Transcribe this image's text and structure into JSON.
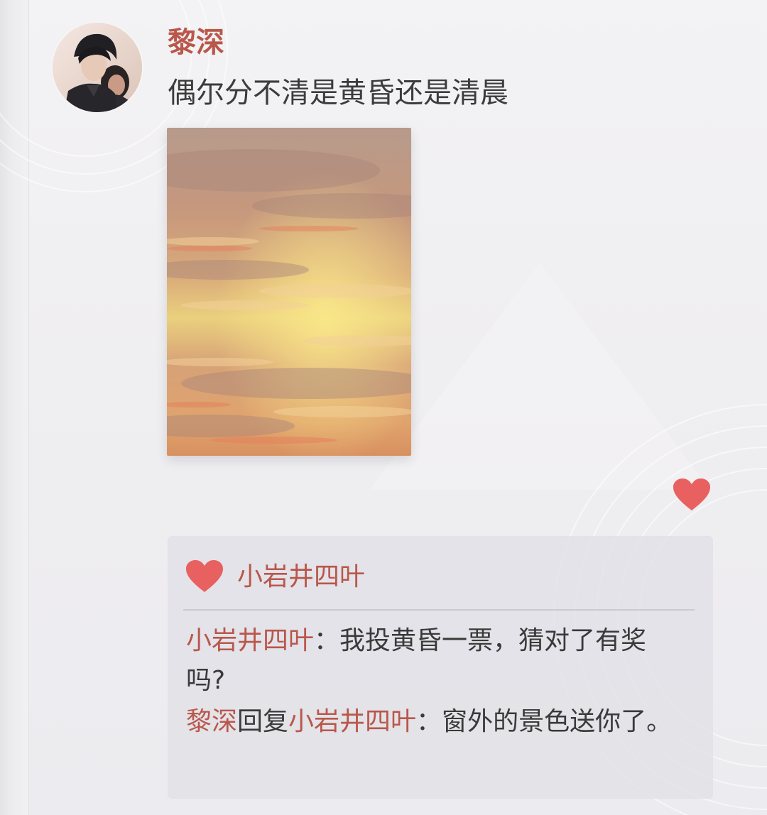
{
  "post": {
    "author": "黎深",
    "text": "偶尔分不清是黄昏还是清晨",
    "photo_subject": "sunset sky with clouds",
    "avatar_subject": "two characters portrait"
  },
  "likes": {
    "icon": "heart-icon",
    "names": "小岩井四叶"
  },
  "comments": [
    {
      "user": "小岩井四叶",
      "sep": "：",
      "text": "我投黄昏一票，猜对了有奖吗?"
    },
    {
      "user": "黎深",
      "reply_word": "回复",
      "reply_to": "小岩井四叶",
      "sep": "：",
      "text": "窗外的景色送你了。"
    }
  ],
  "colors": {
    "accent": "#b9574b",
    "heart": "#e8605f",
    "text": "#3c3c3c",
    "panel": "#e1e1e7"
  }
}
